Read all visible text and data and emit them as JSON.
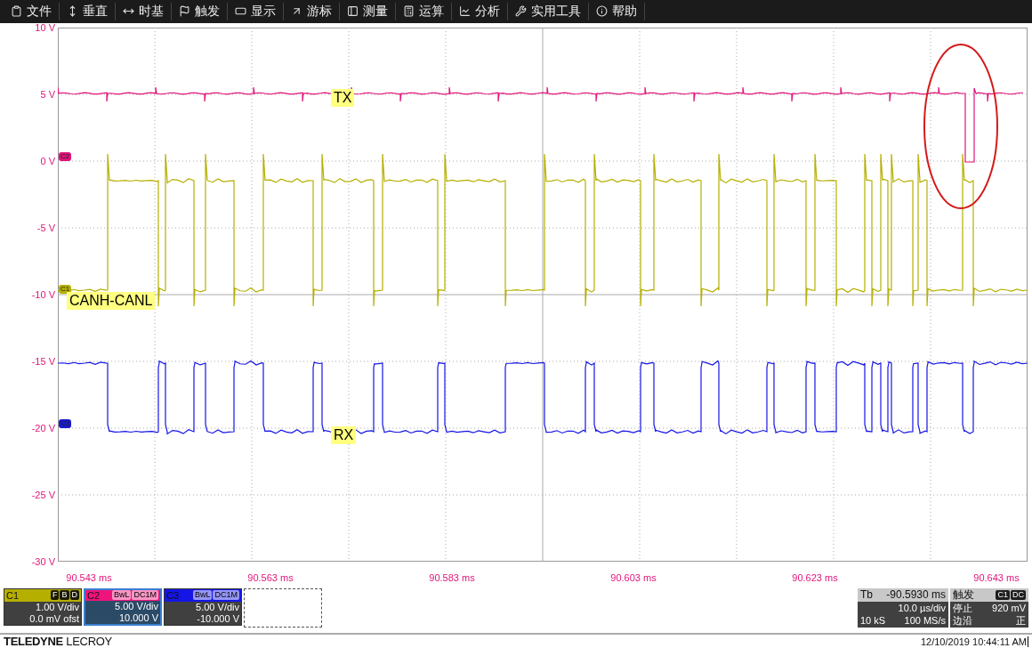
{
  "menu": [
    {
      "label": "文件"
    },
    {
      "label": "垂直"
    },
    {
      "label": "时基"
    },
    {
      "label": "触发"
    },
    {
      "label": "显示"
    },
    {
      "label": "游标"
    },
    {
      "label": "测量"
    },
    {
      "label": "运算"
    },
    {
      "label": "分析"
    },
    {
      "label": "实用工具"
    },
    {
      "label": "帮助"
    }
  ],
  "plot": {
    "y_labels": [
      "10 V",
      "5 V",
      "0 V",
      "-5 V",
      "-10 V",
      "-15 V",
      "-20 V",
      "-25 V",
      "-30 V"
    ],
    "x_labels": [
      "90.543 ms",
      "90.563 ms",
      "90.583 ms",
      "90.603 ms",
      "90.623 ms",
      "90.643 ms"
    ],
    "channel_markers": [
      {
        "label": "C2",
        "color": "#e0157a"
      },
      {
        "label": "C1",
        "color": "#b5b000"
      },
      {
        "label": "C3",
        "color": "#1a1ad0"
      }
    ],
    "trace_labels": [
      {
        "text": "TX"
      },
      {
        "text": "CANH-CANL"
      },
      {
        "text": "RX"
      }
    ]
  },
  "channels": [
    {
      "name": "C1",
      "color": "#b5b000",
      "tags": [
        "F",
        "B",
        "D"
      ],
      "lines": [
        "1.00 V/div",
        "0.0 mV ofst"
      ],
      "selected": false
    },
    {
      "name": "C2",
      "color": "#f0147d",
      "tags": [
        "BwL",
        "DC1M"
      ],
      "lines": [
        "5.00 V/div",
        "10.000 V"
      ],
      "selected": true
    },
    {
      "name": "C3",
      "color": "#1515e6",
      "tags": [
        "BwL",
        "DC1M"
      ],
      "lines": [
        "5.00 V/div",
        "-10.000 V"
      ],
      "selected": false
    }
  ],
  "timebase": {
    "label": "Tb",
    "delay": "-90.5930 ms",
    "scale": "10.0 µs/div",
    "samples": "10 kS",
    "rate": "100 MS/s"
  },
  "trigger": {
    "label": "触发",
    "tags": [
      "C1",
      "DC"
    ],
    "state": "停止",
    "level": "920 mV",
    "type": "边沿",
    "slope": "正"
  },
  "brand": "**TELEDYNE** LECROY",
  "datetime": "12/10/2019 10:44:11 AM"
}
